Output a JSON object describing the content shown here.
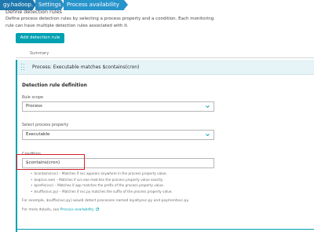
{
  "breadcrumbs": [
    {
      "label": "gy.hadoop.co"
    },
    {
      "label": "Settings"
    },
    {
      "label": "Process availability"
    }
  ],
  "section": {
    "title": "Define detection rules",
    "description": "Define process detection rules by selecting a process property and a condition. Each monitoring rule can have multiple detection rules associated with it."
  },
  "add_button": "Add detection rule",
  "summary_header": "Summary",
  "rule": {
    "label": "Process: Executable matches $contains(cron)"
  },
  "definition": {
    "title": "Detection rule definition",
    "scope_label": "Rule scope",
    "scope_value": "Process",
    "property_label": "Select process property",
    "property_value": "Executable",
    "condition_label": "Condition",
    "condition_value": "$contains(cron)"
  },
  "help_items": [
    "$contains(svc) – Matches if svc appears anywhere in the process property value.",
    "$eq(svc.exe) – Matches if svc.exe matches the process property value exactly.",
    "$prefix(svc) – Matches if app matches the prefix of the process property value.",
    "$suffix(svc.py) – Matches if svc.py matches the suffix of the process property value."
  ],
  "example_text": "For example, $suffix(svc.py) would detect processes named loyaltysvc.py and paymentsvc.py.",
  "details": {
    "prefix": "For more details, see ",
    "link": "Process availability"
  },
  "colors": {
    "accent": "#00a1b2",
    "breadcrumb": "#2a8fc4",
    "highlight": "#d8212b"
  }
}
